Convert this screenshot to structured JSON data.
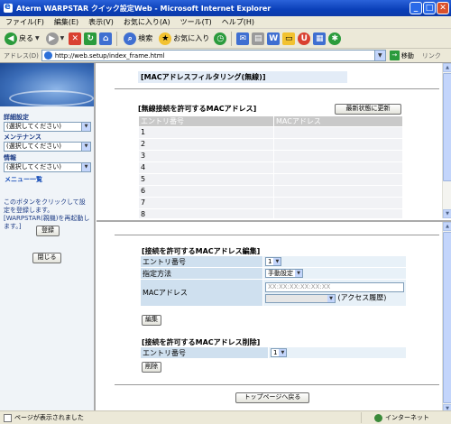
{
  "window": {
    "title": "Aterm WARPSTAR クイック設定Web - Microsoft Internet Explorer"
  },
  "menu": [
    "ファイル(F)",
    "編集(E)",
    "表示(V)",
    "お気に入り(A)",
    "ツール(T)",
    "ヘルプ(H)"
  ],
  "toolbar": {
    "back_label": "戻る",
    "search_label": "検索",
    "favorites_label": "お気に入り"
  },
  "address": {
    "label": "アドレス(D)",
    "url": "http://web.setup/index_frame.html",
    "go_label": "移動",
    "links_label": "リンク"
  },
  "left": {
    "sections": [
      {
        "label": "詳細設定",
        "select": "(選択してください)"
      },
      {
        "label": "メンテナンス",
        "select": "(選択してください)"
      },
      {
        "label": "情報",
        "select": "(選択してください)"
      }
    ],
    "menu_list": "メニュー一覧",
    "note": "このボタンをクリックして設定を登録します。[WARPSTAR(親機)を再起動します。]",
    "register_button": "登録",
    "close_button": "閉じる"
  },
  "top": {
    "heading": "[MACアドレスフィルタリング(無線)]",
    "section_title": "[無線接続を許可するMACアドレス]",
    "refresh_button": "最新状態に更新",
    "columns": [
      "エントリ番号",
      "MACアドレス"
    ],
    "rows": [
      "1",
      "2",
      "3",
      "4",
      "5",
      "6",
      "7",
      "8"
    ]
  },
  "edit": {
    "title": "[接続を許可するMACアドレス編集]",
    "entry_label": "エントリ番号",
    "entry_value": "1",
    "method_label": "指定方法",
    "method_value": "手動設定",
    "mac_label": "MACアドレス",
    "mac_placeholder": "XX:XX:XX:XX:XX:XX",
    "history_label": "(アクセス履歴)",
    "edit_button": "編集"
  },
  "delete": {
    "title": "[接続を許可するMACアドレス削除]",
    "entry_label": "エントリ番号",
    "entry_value": "1",
    "delete_button": "削除"
  },
  "top_page_button": "トップページへ戻る",
  "status": {
    "text": "ページが表示されました",
    "zone": "インターネット"
  }
}
